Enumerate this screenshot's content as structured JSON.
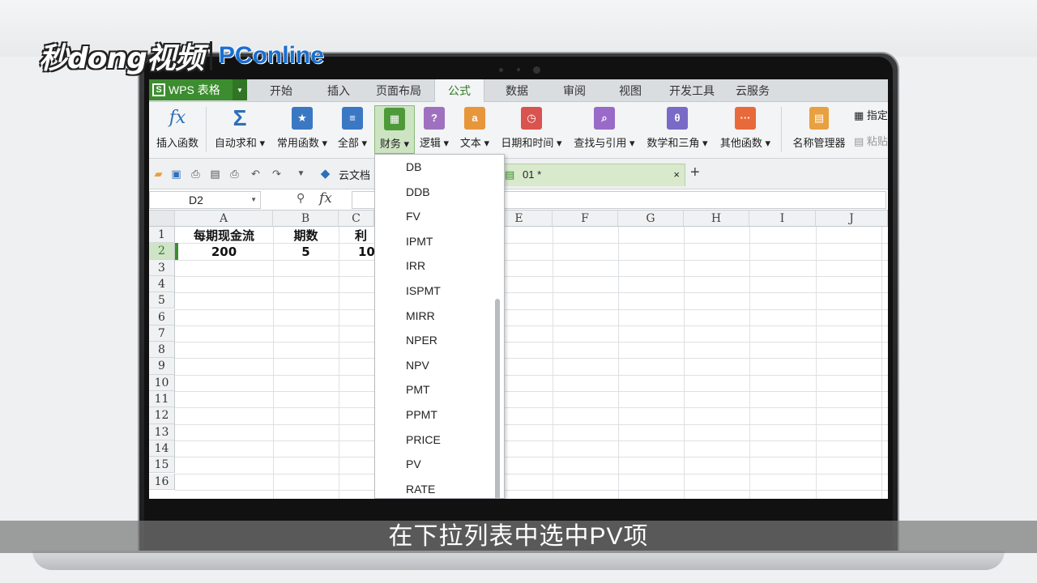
{
  "watermark": {
    "brand_a": "秒dong视频",
    "brand_b": "PConline"
  },
  "subtitle": "在下拉列表中选中PV项",
  "app": {
    "name": "WPS 表格"
  },
  "menu_tabs": [
    {
      "label": "开始"
    },
    {
      "label": "插入"
    },
    {
      "label": "页面布局"
    },
    {
      "label": "公式",
      "active": true
    },
    {
      "label": "数据"
    },
    {
      "label": "审阅"
    },
    {
      "label": "视图"
    },
    {
      "label": "开发工具"
    },
    {
      "label": "云服务"
    }
  ],
  "ribbon": {
    "buttons": [
      {
        "label": "插入函数",
        "icon": "fx-icon"
      },
      {
        "label": "自动求和 ▾",
        "icon": "sigma-icon"
      },
      {
        "label": "常用函数 ▾",
        "icon": "star-book-icon"
      },
      {
        "label": "全部 ▾",
        "icon": "list-book-icon"
      },
      {
        "label": "财务 ▾",
        "icon": "finance-book-icon",
        "pressed": true
      },
      {
        "label": "逻辑 ▾",
        "icon": "question-book-icon"
      },
      {
        "label": "文本 ▾",
        "icon": "text-book-icon"
      },
      {
        "label": "日期和时间 ▾",
        "icon": "clock-book-icon"
      },
      {
        "label": "查找与引用 ▾",
        "icon": "search-book-icon"
      },
      {
        "label": "数学和三角 ▾",
        "icon": "theta-book-icon"
      },
      {
        "label": "其他函数 ▾",
        "icon": "more-book-icon"
      },
      {
        "label": "名称管理器",
        "icon": "name-manager-icon"
      }
    ],
    "side_items": [
      "指定",
      "粘贴"
    ]
  },
  "quick_toolbar": {
    "cloud_label": "云文档"
  },
  "doc_tab": {
    "label": "01 *",
    "close": "×",
    "add": "+"
  },
  "formula_bar": {
    "name_box": "D2",
    "fx": "fx",
    "zoom": "🔍"
  },
  "columns": [
    "A",
    "B",
    "C",
    "E",
    "F",
    "G",
    "H",
    "I",
    "J"
  ],
  "rows": [
    "1",
    "2",
    "3",
    "4",
    "5",
    "6",
    "7",
    "8",
    "9",
    "10",
    "11",
    "12",
    "13",
    "14",
    "15",
    "16"
  ],
  "cells": {
    "a1": "每期现金流",
    "b1": "期数",
    "c1": "利",
    "a2": "200",
    "b2": "5",
    "c2": "10"
  },
  "dropdown_items": [
    "DB",
    "DDB",
    "FV",
    "IPMT",
    "IRR",
    "ISPMT",
    "MIRR",
    "NPER",
    "NPV",
    "PMT",
    "PPMT",
    "PRICE",
    "PV",
    "RATE"
  ],
  "colors": {
    "accent": "#3c8d2f",
    "pressed_bg": "#cde4c3"
  }
}
